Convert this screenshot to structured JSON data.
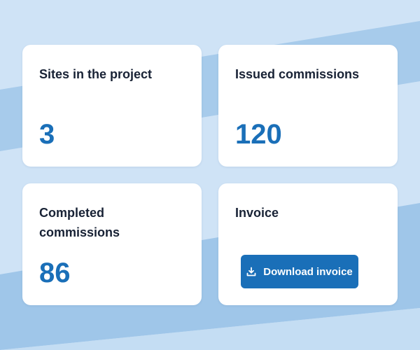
{
  "cards": {
    "sites": {
      "title": "Sites in the project",
      "value": "3"
    },
    "issued": {
      "title": "Issued commissions",
      "value": "120"
    },
    "completed": {
      "title": "Completed commissions",
      "value": "86"
    },
    "invoice": {
      "title": "Invoice",
      "button_label": "Download invoice",
      "button_icon": "download-icon"
    }
  },
  "colors": {
    "background": "#cfe3f6",
    "band": "#a9ccec",
    "accent": "#1a6fb8",
    "title_text": "#182235",
    "card": "#ffffff"
  }
}
